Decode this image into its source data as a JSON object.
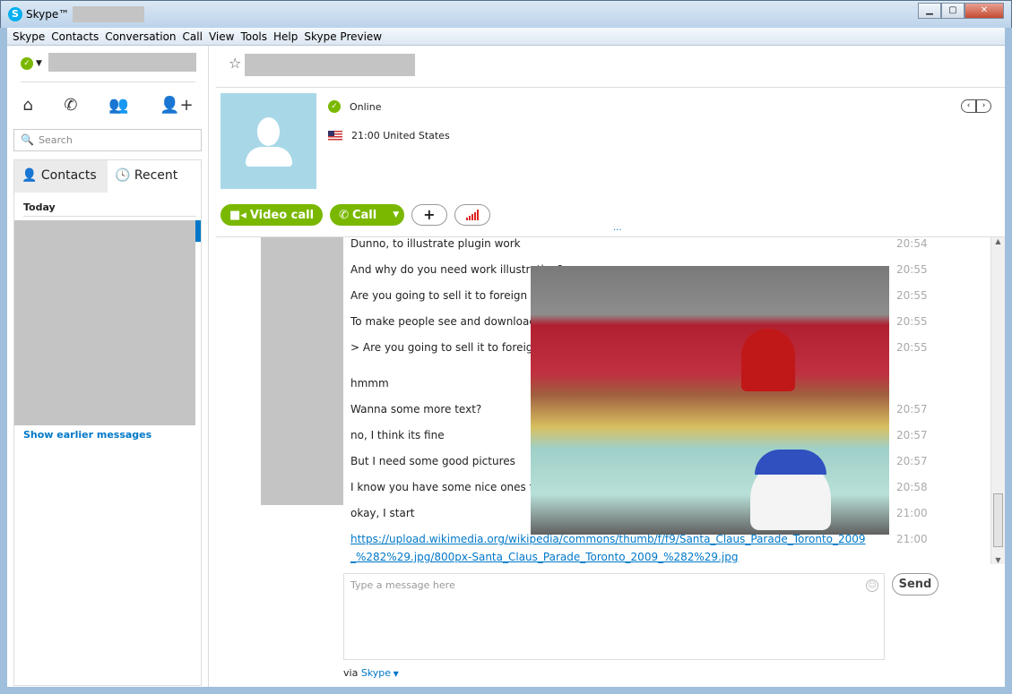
{
  "window": {
    "title": "Skype™ -",
    "buttons": [
      "minimize",
      "maximize",
      "close"
    ]
  },
  "menu": [
    "Skype",
    "Contacts",
    "Conversation",
    "Call",
    "View",
    "Tools",
    "Help",
    "Skype Preview"
  ],
  "sidebar": {
    "search_placeholder": "Search",
    "nav_icons": [
      "home-icon",
      "phone-icon",
      "group-icon",
      "add-contact-icon"
    ],
    "tabs": [
      {
        "label": "Contacts",
        "active": true
      },
      {
        "label": "Recent",
        "active": false
      }
    ],
    "section": "Today",
    "show_earlier": "Show earlier messages",
    "accent": "#0078c8"
  },
  "contact": {
    "status": "Online",
    "local_time": "21:00 United States",
    "status_color": "#7ab800"
  },
  "actions": {
    "video_call": "Video call",
    "call": "Call",
    "add": "+"
  },
  "messages": [
    {
      "text": "Dunno, to illustrate plugin work",
      "time": "20:54"
    },
    {
      "text": "And why do you need work illustration?",
      "time": "20:55"
    },
    {
      "text": "Are you going to sell it to foreign agents?",
      "time": "20:55"
    },
    {
      "text": "To make people see and download the plugin",
      "time": "20:55"
    },
    {
      "text": "> Are you going to sell it to foreign agents?",
      "time": "20:55"
    },
    {
      "text": "hmmm",
      "time": ""
    },
    {
      "text": "Wanna some more text?",
      "time": "20:57"
    },
    {
      "text": "no, I think its fine",
      "time": "20:57"
    },
    {
      "text": "But I need some good pictures",
      "time": "20:57"
    },
    {
      "text": "I know you have some nice ones for me",
      "time": "20:58"
    },
    {
      "text": "okay, I start",
      "time": "21:00"
    },
    {
      "text": "https://upload.wikimedia.org/wikipedia/commons/thumb/f/f9/Santa_Claus_Parade_Toronto_2009_%282%29.jpg/800px-Santa_Claus_Parade_Toronto_2009_%282%29.jpg",
      "time": "21:00",
      "link": true
    }
  ],
  "composer": {
    "placeholder": "Type a message here",
    "send": "Send",
    "via": "via",
    "via_service": "Skype"
  }
}
